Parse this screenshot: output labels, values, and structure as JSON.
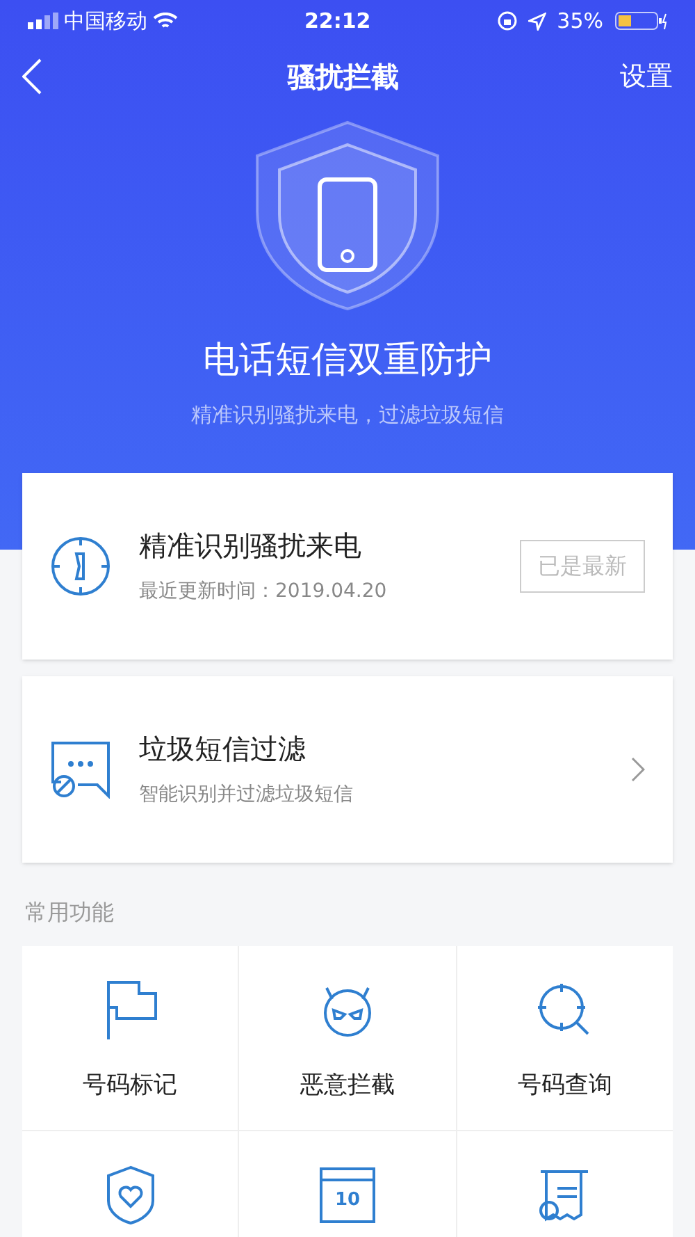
{
  "status_bar": {
    "carrier": "中国移动",
    "time": "22:12",
    "battery": "35%"
  },
  "nav": {
    "title": "骚扰拦截",
    "action": "设置"
  },
  "hero": {
    "title": "电话短信双重防护",
    "subtitle": "精准识别骚扰来电，过滤垃圾短信"
  },
  "cards": [
    {
      "kind": "update",
      "title": "精准识别骚扰来电",
      "subtitle": "最近更新时间：2019.04.20",
      "button": {
        "label": "已是最新",
        "disabled": true
      }
    },
    {
      "kind": "link",
      "title": "垃圾短信过滤",
      "subtitle": "智能识别并过滤垃圾短信"
    }
  ],
  "section_title": "常用功能",
  "features": [
    {
      "kind": "flag",
      "label": "号码标记"
    },
    {
      "kind": "devil",
      "label": "恶意拦截"
    },
    {
      "kind": "search",
      "label": "号码查询"
    },
    {
      "kind": "shield"
    },
    {
      "kind": "calendar",
      "icon_text": "10"
    },
    {
      "kind": "receipt"
    }
  ]
}
